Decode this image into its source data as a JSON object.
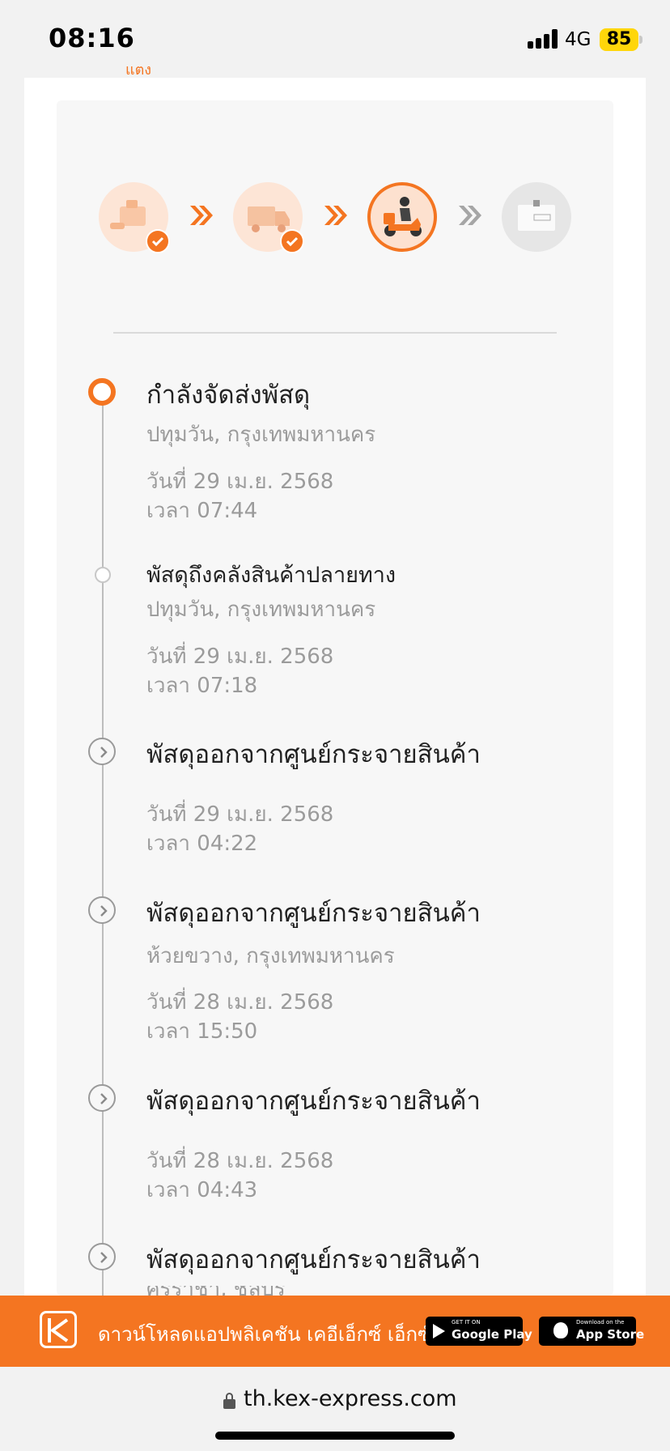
{
  "status_bar": {
    "time": "08:16",
    "network": "4G",
    "battery": "85"
  },
  "header": {
    "cut_label": "แต่ง"
  },
  "progress_steps": [
    {
      "name": "received",
      "state": "done"
    },
    {
      "name": "in-transit",
      "state": "done"
    },
    {
      "name": "out-for-delivery",
      "state": "current"
    },
    {
      "name": "delivered",
      "state": "pending"
    }
  ],
  "timeline": [
    {
      "title": "กำลังจัดส่งพัสดุ",
      "location": "ปทุมวัน, กรุงเทพมหานคร",
      "date": "วันที่ 29 เม.ย. 2568",
      "time": "เวลา 07:44"
    },
    {
      "title": "พัสดุถึงคลังสินค้าปลายทาง",
      "location": "ปทุมวัน, กรุงเทพมหานคร",
      "date": "วันที่ 29 เม.ย. 2568",
      "time": "เวลา 07:18"
    },
    {
      "title": "พัสดุออกจากศูนย์กระจายสินค้า",
      "date": "วันที่ 29 เม.ย. 2568",
      "time": "เวลา 04:22"
    },
    {
      "title": "พัสดุออกจากศูนย์กระจายสินค้า",
      "location": "ห้วยขวาง, กรุงเทพมหานคร",
      "date": "วันที่ 28 เม.ย. 2568",
      "time": "เวลา 15:50"
    },
    {
      "title": "พัสดุออกจากศูนย์กระจายสินค้า",
      "date": "วันที่ 28 เม.ย. 2568",
      "time": "เวลา 04:43"
    },
    {
      "title": "พัสดุออกจากศูนย์กระจายสินค้า",
      "location_partial": "ศรีราชา, ชลบุรี"
    }
  ],
  "banner": {
    "text": "ดาวน์โหลดแอปพลิเคชัน เคอีเอ็กซ์ เอ็กซ์เพรส",
    "google_play_small": "GET IT ON",
    "google_play_big": "Google Play",
    "app_store_small": "Download on the",
    "app_store_big": "App Store"
  },
  "browser": {
    "url": "th.kex-express.com"
  },
  "colors": {
    "accent": "#f47521",
    "panel": "#f7f7f7",
    "muted_text": "#9b9b9b"
  }
}
